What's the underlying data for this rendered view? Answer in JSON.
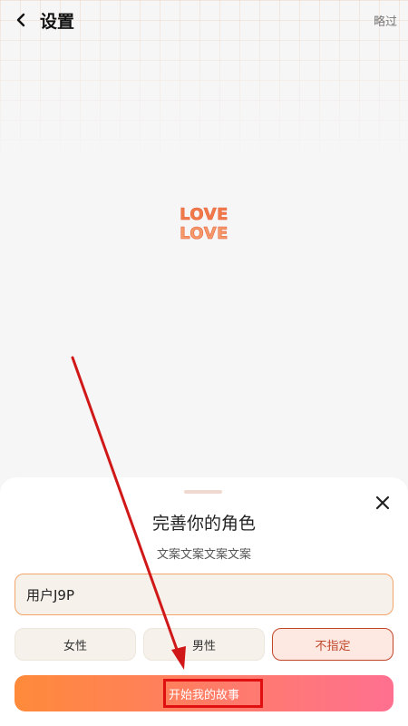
{
  "header": {
    "title": "设置",
    "skip_label": "略过",
    "back_icon": "chevron-left-icon"
  },
  "logo": {
    "line1": "LOVE",
    "line2": "LOVE"
  },
  "sheet": {
    "title": "完善你的角色",
    "subtitle": "文案文案文案文案",
    "name_value": "用户J9P",
    "close_icon": "close-icon",
    "gender_options": [
      {
        "label": "女性"
      },
      {
        "label": "男性"
      },
      {
        "label": "不指定"
      }
    ],
    "selected_gender": "不指定",
    "start_label": "开始我的故事"
  },
  "colors": {
    "accent_orange": "#ff8a3a",
    "accent_pink": "#ff7090",
    "selected_red": "#c0462a",
    "annotation_red": "#e01010"
  }
}
